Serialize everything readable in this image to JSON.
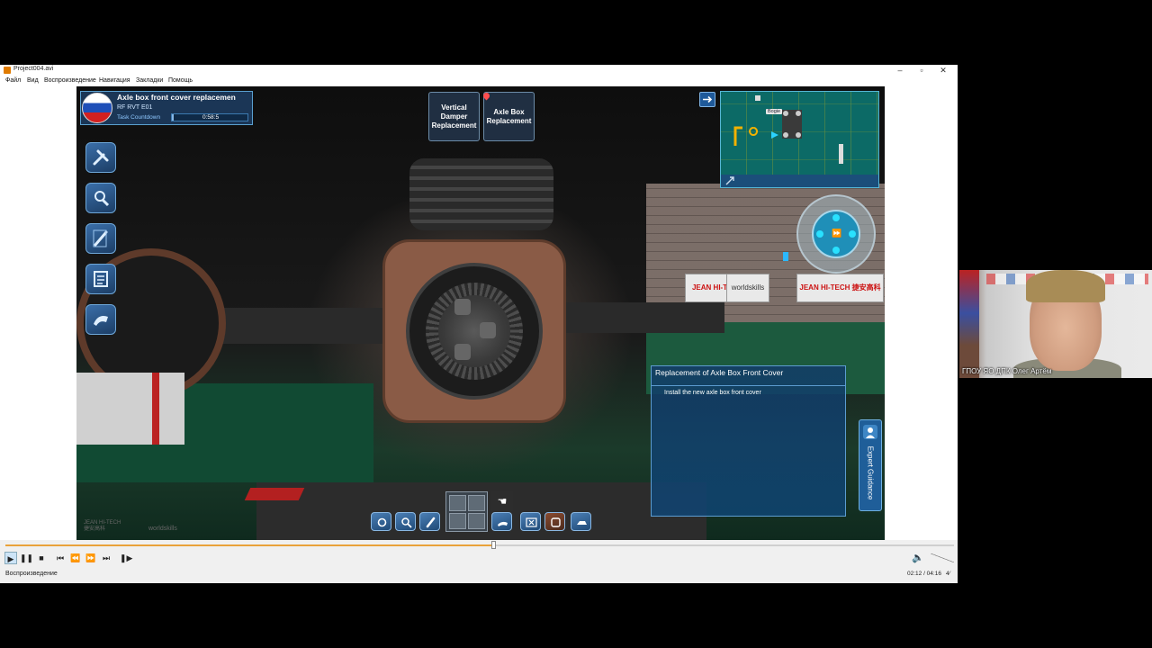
{
  "window": {
    "title": "Project004.avi",
    "controls": [
      "–",
      "▫",
      "✕"
    ]
  },
  "menu": [
    "Файл",
    "Вид",
    "Воспроизведение",
    "Навигация",
    "Закладки",
    "Помощь"
  ],
  "hud": {
    "task": {
      "title": "Axle box front cover replacemen",
      "code": "RF RVT E01",
      "countdown_label": "Task Countdown",
      "countdown_value": "0:58:5",
      "countdown_fraction": 0.02
    },
    "side_buttons": [
      "tools-icon",
      "inspect-icon",
      "pen-icon",
      "notes-icon",
      "glove-icon"
    ],
    "steps": [
      {
        "label": "Vertical Damper Replacement"
      },
      {
        "label": "Axle Box Replacement"
      }
    ],
    "minimap": {
      "bogie_label": "Bogie"
    },
    "guide": {
      "title": "Replacement of Axle Box Front Cover",
      "instruction": "Install the new axle box front cover"
    },
    "expert_guidance": "Expert Guidance",
    "toolbar_icons": [
      "wrench-icon",
      "search-icon",
      "bolt-icon",
      "hand-icon",
      "clear-icon",
      "cover-icon",
      "tool-car-icon"
    ],
    "banners": [
      "JEAN HI-TECH",
      "worldskills",
      "JEAN HI-TECH 捷安高科"
    ],
    "watermark": "JEAN HI-TECH",
    "watermark_sub": "捷安高科",
    "watermark_ws": "worldskills"
  },
  "player": {
    "progress_fraction": 0.516,
    "status": "Воспроизведение",
    "time": "02:12 / 04:16",
    "status_extra": "4⁄"
  },
  "webcam": {
    "label": "ГПОУ ЯО ДПК Олег Артём"
  },
  "colors": {
    "hud_blue": "#1c3a5c",
    "accent_cyan": "#29e1ff",
    "seek_orange": "#e9a13a"
  }
}
